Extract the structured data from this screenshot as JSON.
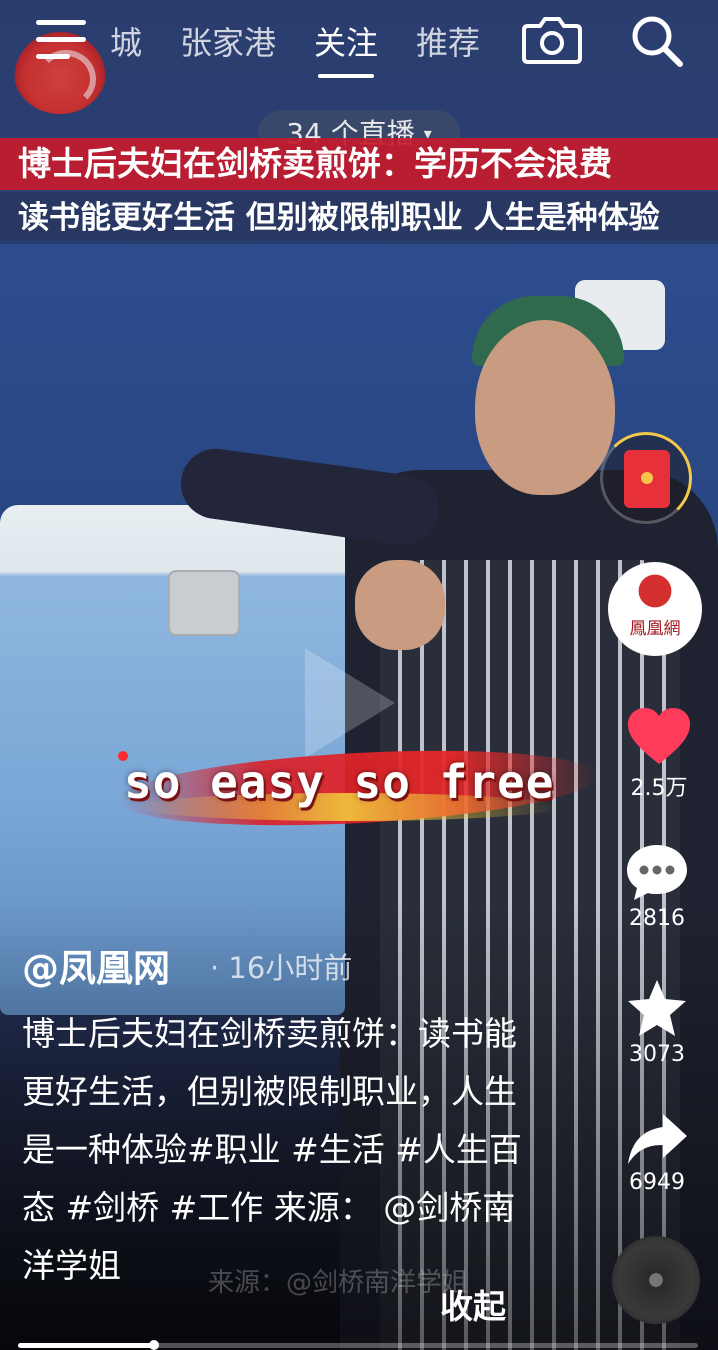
{
  "nav": {
    "tabs": [
      "城",
      "张家港",
      "关注",
      "推荐"
    ],
    "active_tab": "关注"
  },
  "live_pill": "34 个直播",
  "headline": {
    "line1": "博士后夫妇在剑桥卖煎饼：学历不会浪费",
    "line2": "读书能更好生活 但别被限制职业 人生是种体验"
  },
  "sticker_text": "so easy so free",
  "avatar_name": "鳳凰網",
  "actions": {
    "likes": "2.5万",
    "comments": "2816",
    "favorites": "3073",
    "shares": "6949"
  },
  "post": {
    "author": "@凤凰网",
    "time": "· 16小时前",
    "description": "博士后夫妇在剑桥卖煎饼：读书能更好生活，但别被限制职业，人生是一种体验#职业 #生活 #人生百态 #剑桥 #工作 来源： @剑桥南洋学姐",
    "watermark": "来源：@剑桥南洋学姐",
    "collapse": "收起"
  },
  "playback_progress": 0.2,
  "colors": {
    "headline_red": "#c41a2c",
    "like_heart": "#ff3b5c",
    "sticker_red": "#e02828"
  },
  "icons": [
    "menu-icon",
    "camera-icon",
    "search-icon",
    "red-packet-icon",
    "heart-icon",
    "comment-icon",
    "star-icon",
    "share-icon",
    "music-disc-icon"
  ]
}
